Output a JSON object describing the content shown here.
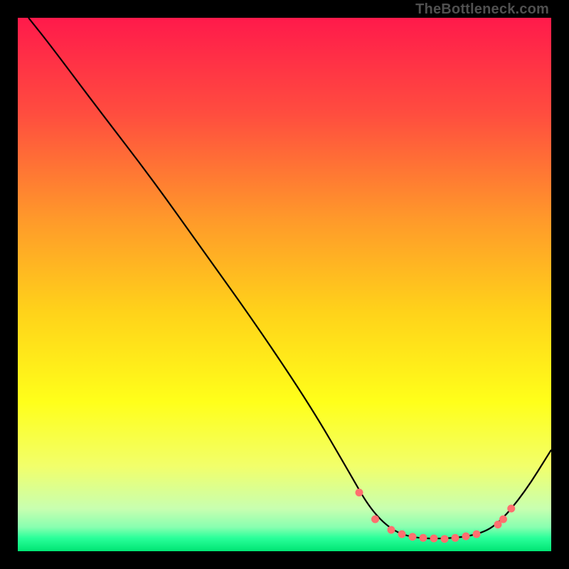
{
  "watermark": "TheBottleneck.com",
  "chart_data": {
    "type": "line",
    "title": "",
    "xlabel": "",
    "ylabel": "",
    "xlim": [
      0,
      100
    ],
    "ylim": [
      0,
      100
    ],
    "background_gradient": {
      "stops": [
        {
          "offset": 0.0,
          "color": "#ff1a4b"
        },
        {
          "offset": 0.18,
          "color": "#ff4d3f"
        },
        {
          "offset": 0.38,
          "color": "#ff9a2a"
        },
        {
          "offset": 0.55,
          "color": "#ffd21a"
        },
        {
          "offset": 0.72,
          "color": "#ffff1a"
        },
        {
          "offset": 0.84,
          "color": "#f2ff6a"
        },
        {
          "offset": 0.92,
          "color": "#c8ffb0"
        },
        {
          "offset": 0.955,
          "color": "#88ffb0"
        },
        {
          "offset": 0.975,
          "color": "#2aff9a"
        },
        {
          "offset": 1.0,
          "color": "#00e574"
        }
      ]
    },
    "series": [
      {
        "name": "bottleneck-curve",
        "stroke": "#000000",
        "stroke_width": 2.2,
        "points": [
          {
            "x": 2,
            "y": 100
          },
          {
            "x": 6,
            "y": 95
          },
          {
            "x": 15,
            "y": 83
          },
          {
            "x": 25,
            "y": 70
          },
          {
            "x": 35,
            "y": 56
          },
          {
            "x": 45,
            "y": 42
          },
          {
            "x": 55,
            "y": 27
          },
          {
            "x": 62,
            "y": 15
          },
          {
            "x": 66,
            "y": 8
          },
          {
            "x": 70,
            "y": 4
          },
          {
            "x": 74,
            "y": 2.5
          },
          {
            "x": 80,
            "y": 2.3
          },
          {
            "x": 86,
            "y": 3
          },
          {
            "x": 90,
            "y": 5
          },
          {
            "x": 95,
            "y": 11
          },
          {
            "x": 100,
            "y": 19
          }
        ]
      }
    ],
    "markers": {
      "color": "#ff6f6f",
      "radius": 5.5,
      "points": [
        {
          "x": 64,
          "y": 11
        },
        {
          "x": 67,
          "y": 6
        },
        {
          "x": 70,
          "y": 4
        },
        {
          "x": 72,
          "y": 3.2
        },
        {
          "x": 74,
          "y": 2.7
        },
        {
          "x": 76,
          "y": 2.5
        },
        {
          "x": 78,
          "y": 2.4
        },
        {
          "x": 80,
          "y": 2.3
        },
        {
          "x": 82,
          "y": 2.5
        },
        {
          "x": 84,
          "y": 2.8
        },
        {
          "x": 86,
          "y": 3.2
        },
        {
          "x": 90,
          "y": 5
        },
        {
          "x": 91,
          "y": 6
        },
        {
          "x": 92.5,
          "y": 8
        }
      ]
    }
  }
}
